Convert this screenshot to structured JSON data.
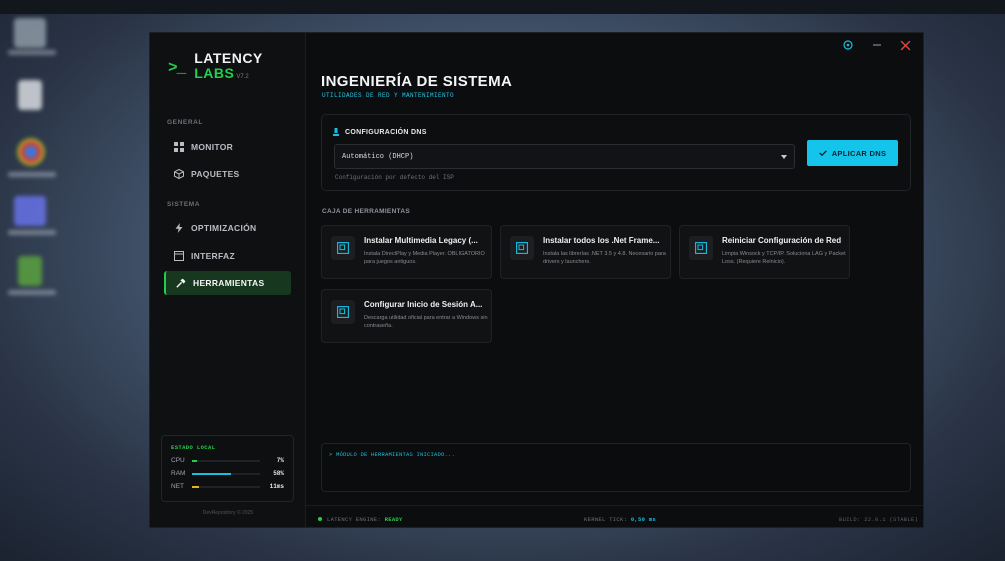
{
  "app": {
    "logo_prompt": ">_",
    "logo_line1": "LATENCY",
    "logo_line2": "LABS",
    "version": "V7.2",
    "accent_green": "#22d04a",
    "accent_cyan": "#14c4ea"
  },
  "sidebar": {
    "section_general": "GENERAL",
    "section_system": "SISTEMA",
    "items": [
      {
        "label": "MONITOR",
        "icon": "grid-icon"
      },
      {
        "label": "PAQUETES",
        "icon": "package-icon"
      },
      {
        "label": "OPTIMIZACIÓN",
        "icon": "bolt-icon"
      },
      {
        "label": "INTERFAZ",
        "icon": "window-icon"
      },
      {
        "label": "HERRAMIENTAS",
        "icon": "hammer-icon",
        "active": true
      }
    ],
    "stats": {
      "title": "ESTADO LOCAL",
      "rows": [
        {
          "label": "CPU",
          "value": "7%",
          "fill": 0.07,
          "color": "#22d04a"
        },
        {
          "label": "RAM",
          "value": "58%",
          "fill": 0.58,
          "color": "#18bfe0"
        },
        {
          "label": "NET",
          "value": "11ms",
          "fill": 0.11,
          "color": "#e5b31f"
        }
      ]
    },
    "copyright": "DevRepository © 2025"
  },
  "main": {
    "title": "INGENIERÍA DE SISTEMA",
    "subtitle": "UTILIDADES DE RED Y MANTENIMIENTO",
    "dns": {
      "header": "CONFIGURACIÓN DNS",
      "selected": "Automático (DHCP)",
      "hint": "Configuración por defecto del ISP",
      "apply_label": "APLICAR DNS"
    },
    "tools_heading": "CAJA DE HERRAMIENTAS",
    "tools": [
      {
        "title": "Instalar Multimedia Legacy (...",
        "desc": "Instala DirectPlay y Media Player. OBLIGATORIO para juegos antiguos."
      },
      {
        "title": "Instalar todos los .Net Frame...",
        "desc": "Instala las librerías .NET 3.5 y 4.8. Necesario para drivers y launchers."
      },
      {
        "title": "Reiniciar Configuración de Red",
        "desc": "Limpia Winsock y TCP/IP. Soluciona LAG y Packet Loss. (Requiere Reinicio)."
      },
      {
        "title": "Configurar Inicio de Sesión A...",
        "desc": "Descarga utilidad oficial para entrar a Windows sin contraseña."
      }
    ],
    "console_line": "> MÓDULO DE HERRAMIENTAS INICIADO..."
  },
  "footer": {
    "engine_label": "LATENCY ENGINE:",
    "engine_status": "READY",
    "kernel_label": "KERNEL TICK:",
    "kernel_value": "0,50 ms",
    "build": "BUILD: 22.0.1 (STABLE)"
  }
}
